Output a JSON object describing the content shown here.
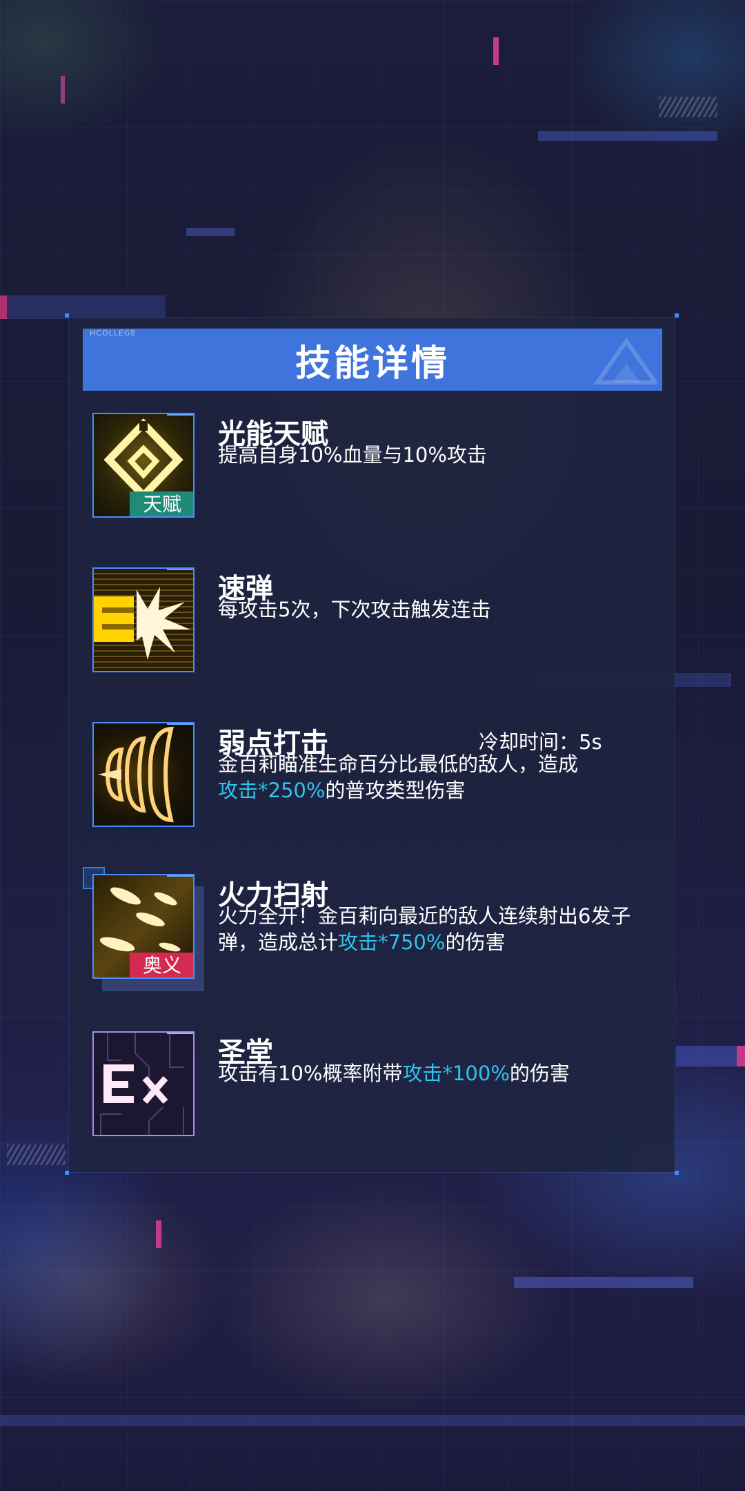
{
  "header": {
    "tag": "HCOLLEGE",
    "title": "技能详情"
  },
  "skills": [
    {
      "name": "光能天赋",
      "description": "提高自身10%血量与10%攻击",
      "badge": "天赋",
      "badge_color": "#1f8a78",
      "icon": "diamond-emblem-icon"
    },
    {
      "name": "速弹",
      "description": "每攻击5次，下次攻击触发连击",
      "icon": "rapid-bullet-icon"
    },
    {
      "name": "弱点打击",
      "cooldown": "冷却时间：5s",
      "description_pre": "金百莉瞄准生命百分比最低的敌人，造成",
      "description_hl": "攻击*250%",
      "description_post": "的普攻类型伤害",
      "icon": "weak-point-strike-icon"
    },
    {
      "name": "火力扫射",
      "description_pre": "火力全开！金百莉向最近的敌人连续射出6发子弹，造成总计",
      "description_hl": "攻击*750%",
      "description_post": "的伤害",
      "badge": "奥义",
      "badge_color": "#d42a52",
      "icon": "firepower-sweep-icon"
    },
    {
      "name": "圣堂",
      "description_pre": "攻击有10%概率附带",
      "description_hl": "攻击*100%",
      "description_post": "的伤害",
      "icon": "ex-circuit-icon"
    }
  ],
  "colors": {
    "header_bg": "#3f74dd",
    "highlight": "#2fc4ee",
    "panel_bg": "#1e2440",
    "icon_border": "#4a8cff"
  }
}
